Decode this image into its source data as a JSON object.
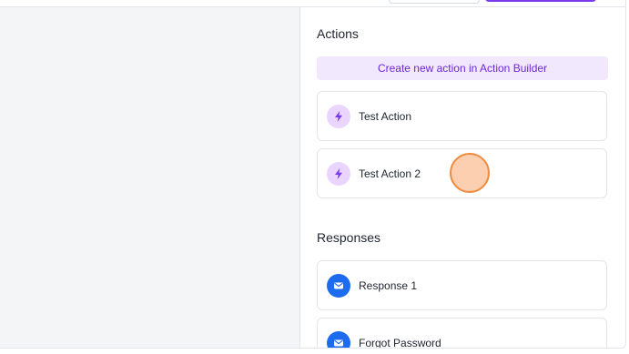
{
  "actions": {
    "title": "Actions",
    "create_label": "Create new action in Action Builder",
    "items": [
      {
        "label": "Test Action",
        "icon": "lightning-bolt-icon"
      },
      {
        "label": "Test Action 2",
        "icon": "lightning-bolt-icon"
      }
    ]
  },
  "responses": {
    "title": "Responses",
    "items": [
      {
        "label": "Response 1",
        "icon": "envelope-icon"
      },
      {
        "label": "Forgot Password",
        "icon": "envelope-icon"
      }
    ]
  },
  "colors": {
    "accent": "#7c3aed",
    "accent_soft": "#f1e8fd",
    "bolt_badge": "#e9d5ff",
    "mail_badge": "#1d6cf0",
    "cursor_highlight": "#f08a3c"
  }
}
